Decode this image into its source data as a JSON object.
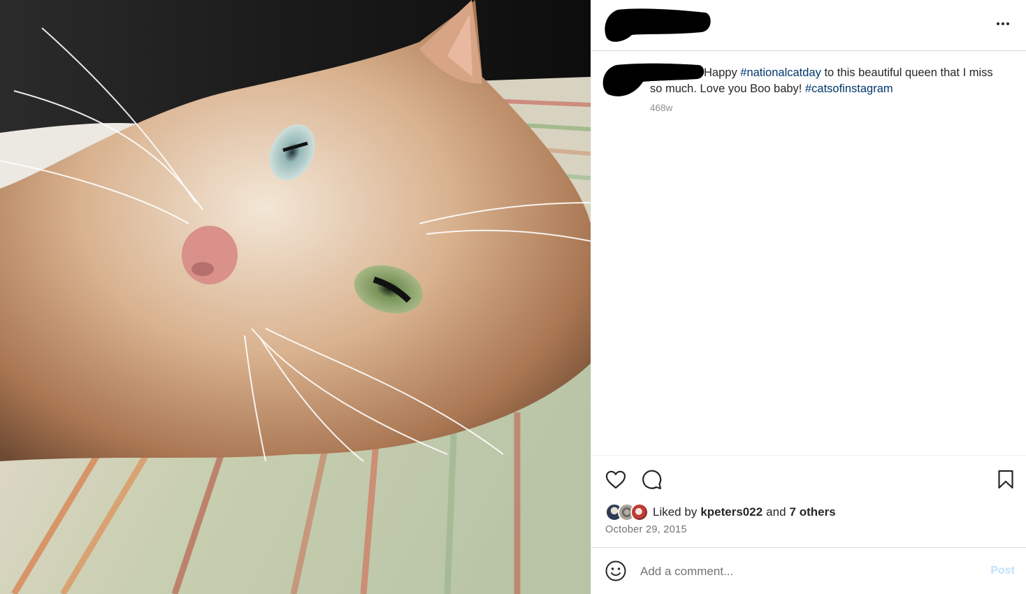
{
  "post": {
    "image_alt": "Orange cat lying on a striped blanket",
    "header": {
      "more_icon": "more-options-icon"
    },
    "caption": {
      "parts": [
        {
          "type": "text",
          "value": "Happy "
        },
        {
          "type": "hashtag",
          "value": "#nationalcatday"
        },
        {
          "type": "text",
          "value": " to this beautiful queen that I miss so much. Love you Boo baby! "
        },
        {
          "type": "hashtag",
          "value": "#catsofinstagram"
        }
      ],
      "age": "468w"
    },
    "actions": {
      "like_icon": "heart-icon",
      "comment_icon": "comment-bubble-icon",
      "save_icon": "bookmark-icon"
    },
    "likes": {
      "prefix": "Liked by",
      "user": "kpeters022",
      "joiner": "and",
      "others": "7 others"
    },
    "date": "October 29, 2015",
    "comment_box": {
      "placeholder": "Add a comment...",
      "post_label": "Post",
      "emoji_icon": "emoji-smiley-icon"
    }
  },
  "colors": {
    "hashtag": "#00376b",
    "post_button_disabled": "#c2e0fd",
    "muted_text": "#737373",
    "border": "#dbdbdb",
    "redaction": "#000000"
  }
}
